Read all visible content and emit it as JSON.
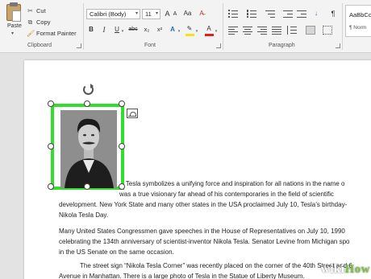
{
  "ribbon": {
    "clipboard": {
      "paste_label": "Paste",
      "cut_label": "Cut",
      "copy_label": "Copy",
      "format_painter_label": "Format Painter",
      "group_label": "Clipboard"
    },
    "font": {
      "font_name": "Calibri (Body)",
      "font_size": "11",
      "grow_label": "A",
      "shrink_label": "A",
      "case_label": "Aa",
      "bold_label": "B",
      "italic_label": "I",
      "underline_label": "U",
      "strike_label": "abc",
      "subscript_label": "x₂",
      "superscript_label": "x²",
      "effects_label": "A",
      "highlight_label": "✎",
      "color_label": "A",
      "group_label": "Font",
      "highlight_color": "#f2e21c",
      "font_color": "#e0201a"
    },
    "paragraph": {
      "pilcrow_label": "¶",
      "sort_label": "↓",
      "group_label": "Paragraph"
    },
    "styles": {
      "preview_sample": "AaBbCc",
      "preview_name": "¶ Norm"
    }
  },
  "document": {
    "paragraph_1": [
      "ola Tesla symbolizes a unifying force and inspiration for all nations in the name o",
      "was a true visionary far ahead of his contemporaries in the field of scientific",
      "development. New York State and many other states in the USA proclaimed July 10, Tesla’s birthday-",
      "Nikola Tesla Day."
    ],
    "paragraph_2": [
      "Many United States Congressmen gave speeches in the House of Representatives on July 10, 1990",
      "celebrating the 134th anniversary of scientist-inventor Nikola Tesla. Senator Levine from Michigan spo",
      "in the US Senate on the same occasion."
    ],
    "paragraph_3": [
      "The street sign “Nikola Tesla Corner” was recently placed on the corner of the 40th Street and 6",
      "Avenue in Manhattan. There is a large photo of Tesla in the Statue of Liberty Museum."
    ]
  },
  "watermark": {
    "part1": "wiki",
    "part2": "How"
  },
  "colors": {
    "selection_border": "#33dd2b",
    "ribbon_bg": "#f3f3f3",
    "canvas_bg": "#e3e3e3"
  }
}
